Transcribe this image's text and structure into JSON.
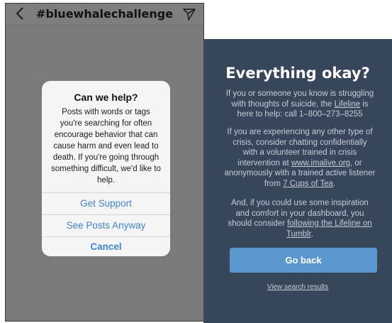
{
  "instagram": {
    "header": {
      "back_icon": "chevron-left-icon",
      "title": "#bluewhalechallenge",
      "send_icon": "paper-plane-icon"
    },
    "dialog": {
      "title": "Can we help?",
      "body_lines": [
        "Posts with words or tags",
        "you're searching for often",
        "encourage behavior that can",
        "cause harm and even lead to",
        "death. If you're going through",
        "something difficult, we'd like to",
        "help."
      ],
      "buttons": {
        "get_support": "Get Support",
        "see_posts": "See Posts Anyway",
        "cancel": "Cancel"
      },
      "link_color": "#3b87d6"
    }
  },
  "tumblr": {
    "title": "Everything okay?",
    "para1": {
      "line1": "If you or someone you know is struggling",
      "line2_pre": "with thoughts of suicide, the ",
      "line2_link": "Lifeline",
      "line2_post": " is",
      "line3": "here to help: call 1–800–273–8255"
    },
    "para2": {
      "line1": "If you are experiencing any other type of",
      "line2": "crisis, consider chatting confidentially",
      "line3": "with a volunteer trained in crisis",
      "line4_pre": "intervention at ",
      "line4_link": "www.imalive.org",
      "line4_post": ", or",
      "line5": "anonymously with a trained active listener",
      "line6_pre": "from ",
      "line6_link": "7 Cups of Tea",
      "line6_post": "."
    },
    "para3": {
      "line1": "And, if you could use some inspiration",
      "line2": "and comfort in your dashboard, you",
      "line3_pre": "should consider ",
      "line3_link": "following the Lifeline on",
      "line4_link": "Tumblr",
      "line4_post": "."
    },
    "go_back": "Go back",
    "view_results": "View search results",
    "colors": {
      "background": "#37465b",
      "button": "#5b98cf"
    }
  }
}
